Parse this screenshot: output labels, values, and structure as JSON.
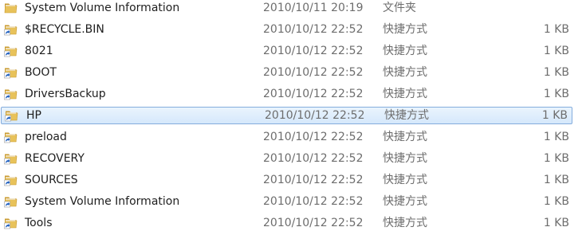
{
  "rows": [
    {
      "name": "System Volume Information",
      "date": "2010/10/11 20:19",
      "type": "文件夹",
      "size": "",
      "icon": "folder-icon",
      "selected": false
    },
    {
      "name": "$RECYCLE.BIN",
      "date": "2010/10/12 22:52",
      "type": "快捷方式",
      "size": "1 KB",
      "icon": "folder-shortcut-icon",
      "selected": false
    },
    {
      "name": "8021",
      "date": "2010/10/12 22:52",
      "type": "快捷方式",
      "size": "1 KB",
      "icon": "folder-shortcut-icon",
      "selected": false
    },
    {
      "name": "BOOT",
      "date": "2010/10/12 22:52",
      "type": "快捷方式",
      "size": "1 KB",
      "icon": "folder-shortcut-icon",
      "selected": false
    },
    {
      "name": "DriversBackup",
      "date": "2010/10/12 22:52",
      "type": "快捷方式",
      "size": "1 KB",
      "icon": "folder-shortcut-icon",
      "selected": false
    },
    {
      "name": "HP",
      "date": "2010/10/12 22:52",
      "type": "快捷方式",
      "size": "1 KB",
      "icon": "folder-shortcut-icon",
      "selected": true
    },
    {
      "name": "preload",
      "date": "2010/10/12 22:52",
      "type": "快捷方式",
      "size": "1 KB",
      "icon": "folder-shortcut-icon",
      "selected": false
    },
    {
      "name": "RECOVERY",
      "date": "2010/10/12 22:52",
      "type": "快捷方式",
      "size": "1 KB",
      "icon": "folder-shortcut-icon",
      "selected": false
    },
    {
      "name": "SOURCES",
      "date": "2010/10/12 22:52",
      "type": "快捷方式",
      "size": "1 KB",
      "icon": "folder-shortcut-icon",
      "selected": false
    },
    {
      "name": "System Volume Information",
      "date": "2010/10/12 22:52",
      "type": "快捷方式",
      "size": "1 KB",
      "icon": "folder-shortcut-icon",
      "selected": false
    },
    {
      "name": "Tools",
      "date": "2010/10/12 22:52",
      "type": "快捷方式",
      "size": "1 KB",
      "icon": "folder-shortcut-icon",
      "selected": false
    }
  ],
  "colors": {
    "folder": "#e8c25a",
    "folder_dark": "#c99a2e",
    "shortcut_arrow": "#1f5fbf",
    "selection_border": "#84acdd",
    "selection_fill": "#d5e8fb"
  }
}
